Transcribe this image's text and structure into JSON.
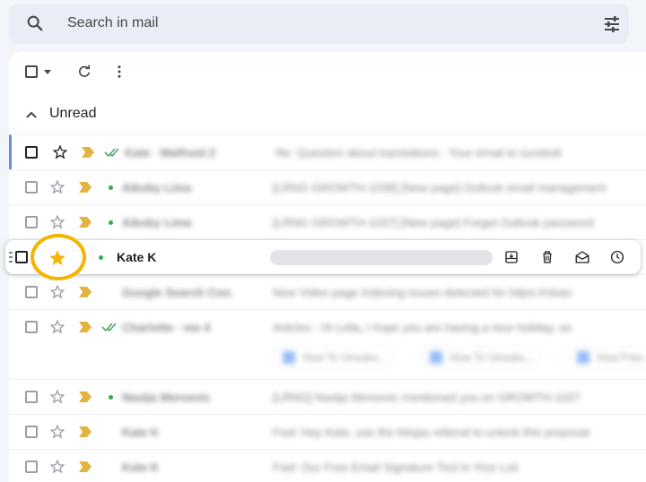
{
  "search": {
    "placeholder": "Search in mail"
  },
  "section": {
    "label": "Unread"
  },
  "hovered": {
    "sender": "Kate K",
    "starred": true
  },
  "rows": [
    {
      "sender": "Kate · Malfroid 2",
      "subject": "Re: Question about translations · Your email to surebolt"
    },
    {
      "sender": "Aikoby Lima",
      "subject": "[LRNG GROWTH-1038] [New page] Outlook email management"
    },
    {
      "sender": "Aikoby Lima",
      "subject": "[LRNG GROWTH-1037] [New page] Forgot Outlook password"
    },
    {
      "sender": "Google Search Con.",
      "subject": "New Video page indexing issues detected for https://clean"
    },
    {
      "sender": "Charlotte · me 4",
      "subject": "Articles - Hi Leila, I hope you are having a nice holiday, as"
    },
    {
      "sender": "Nastja Meroevic",
      "subject": "[LRNG] Nastja Meroevic mentioned you on GROWTH-1027"
    },
    {
      "sender": "Kate K",
      "subject": "Fwd: Hey Kate, use the Ninjas referral to unlock this proposal"
    },
    {
      "sender": "Kate K",
      "subject": "Fwd: Our Free Email Signature Tool in Your List"
    }
  ],
  "attachments": [
    "How To Unsubs...",
    "How To Unsubs...",
    "How Frier..."
  ]
}
